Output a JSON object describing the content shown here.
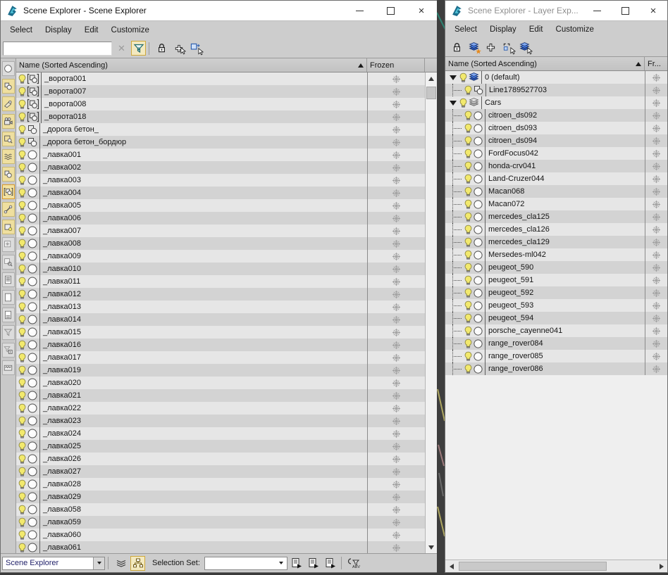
{
  "left_window": {
    "title": "Scene Explorer - Scene Explorer",
    "menu": {
      "select": "Select",
      "display": "Display",
      "edit": "Edit",
      "customize": "Customize"
    },
    "search_value": "",
    "header": {
      "name": "Name (Sorted Ascending)",
      "frozen": "Frozen"
    },
    "rows": [
      {
        "name": "_ворота001",
        "type": "group"
      },
      {
        "name": "_ворота007",
        "type": "group"
      },
      {
        "name": "_ворота008",
        "type": "group"
      },
      {
        "name": "_ворота018",
        "type": "group"
      },
      {
        "name": "_дорога бетон_",
        "type": "shape"
      },
      {
        "name": "_дорога бетон_бордюр",
        "type": "shape"
      },
      {
        "name": "_лавка001",
        "type": "geom"
      },
      {
        "name": "_лавка002",
        "type": "geom"
      },
      {
        "name": "_лавка003",
        "type": "geom"
      },
      {
        "name": "_лавка004",
        "type": "geom"
      },
      {
        "name": "_лавка005",
        "type": "geom"
      },
      {
        "name": "_лавка006",
        "type": "geom"
      },
      {
        "name": "_лавка007",
        "type": "geom"
      },
      {
        "name": "_лавка008",
        "type": "geom"
      },
      {
        "name": "_лавка009",
        "type": "geom"
      },
      {
        "name": "_лавка010",
        "type": "geom"
      },
      {
        "name": "_лавка011",
        "type": "geom"
      },
      {
        "name": "_лавка012",
        "type": "geom"
      },
      {
        "name": "_лавка013",
        "type": "geom"
      },
      {
        "name": "_лавка014",
        "type": "geom"
      },
      {
        "name": "_лавка015",
        "type": "geom"
      },
      {
        "name": "_лавка016",
        "type": "geom"
      },
      {
        "name": "_лавка017",
        "type": "geom"
      },
      {
        "name": "_лавка019",
        "type": "geom"
      },
      {
        "name": "_лавка020",
        "type": "geom"
      },
      {
        "name": "_лавка021",
        "type": "geom"
      },
      {
        "name": "_лавка022",
        "type": "geom"
      },
      {
        "name": "_лавка023",
        "type": "geom"
      },
      {
        "name": "_лавка024",
        "type": "geom"
      },
      {
        "name": "_лавка025",
        "type": "geom"
      },
      {
        "name": "_лавка026",
        "type": "geom"
      },
      {
        "name": "_лавка027",
        "type": "geom"
      },
      {
        "name": "_лавка028",
        "type": "geom"
      },
      {
        "name": "_лавка029",
        "type": "geom"
      },
      {
        "name": "_лавка058",
        "type": "geom"
      },
      {
        "name": "_лавка059",
        "type": "geom"
      },
      {
        "name": "_лавка060",
        "type": "geom"
      },
      {
        "name": "_лавка061",
        "type": "geom"
      }
    ],
    "footer": {
      "explorer_selector": "Scene Explorer",
      "selection_set_label": "Selection Set:",
      "selection_set_value": ""
    },
    "strip_icons": [
      "display-none",
      "display-shapes",
      "display-lights",
      "display-cameras",
      "display-helpers",
      "display-spacewarps",
      "display-groups",
      "display-xrefs",
      "display-bones",
      "display-containers",
      "display-frozen",
      "display-hidden",
      "view-list",
      "view-blank",
      "view-details",
      "filter",
      "filter-combination",
      "filter-custom"
    ]
  },
  "right_window": {
    "title": "Scene Explorer - Layer Exp...",
    "menu": {
      "select": "Select",
      "display": "Display",
      "edit": "Edit",
      "customize": "Customize"
    },
    "header": {
      "name": "Name (Sorted Ascending)",
      "frozen": "Fr..."
    },
    "tree": [
      {
        "label": "0 (default)",
        "type": "layer-blue",
        "level": 0
      },
      {
        "label": "Line1789527703",
        "type": "shape",
        "level": 1
      },
      {
        "label": "Cars",
        "type": "layer-gray",
        "level": 0
      },
      {
        "label": "citroen_ds092",
        "type": "geom",
        "level": 1
      },
      {
        "label": "citroen_ds093",
        "type": "geom",
        "level": 1
      },
      {
        "label": "citroen_ds094",
        "type": "geom",
        "level": 1
      },
      {
        "label": "FordFocus042",
        "type": "geom",
        "level": 1
      },
      {
        "label": "honda-crv041",
        "type": "geom",
        "level": 1
      },
      {
        "label": "Land-Cruzer044",
        "type": "geom",
        "level": 1
      },
      {
        "label": "Macan068",
        "type": "geom",
        "level": 1
      },
      {
        "label": "Macan072",
        "type": "geom",
        "level": 1
      },
      {
        "label": "mercedes_cla125",
        "type": "geom",
        "level": 1
      },
      {
        "label": "mercedes_cla126",
        "type": "geom",
        "level": 1
      },
      {
        "label": "mercedes_cla129",
        "type": "geom",
        "level": 1
      },
      {
        "label": "Mersedes-ml042",
        "type": "geom",
        "level": 1
      },
      {
        "label": "peugeot_590",
        "type": "geom",
        "level": 1
      },
      {
        "label": "peugeot_591",
        "type": "geom",
        "level": 1
      },
      {
        "label": "peugeot_592",
        "type": "geom",
        "level": 1
      },
      {
        "label": "peugeot_593",
        "type": "geom",
        "level": 1
      },
      {
        "label": "peugeot_594",
        "type": "geom",
        "level": 1
      },
      {
        "label": "porsche_cayenne041",
        "type": "geom",
        "level": 1
      },
      {
        "label": "range_rover084",
        "type": "geom",
        "level": 1
      },
      {
        "label": "range_rover085",
        "type": "geom",
        "level": 1
      },
      {
        "label": "range_rover086",
        "type": "geom",
        "level": 1
      }
    ]
  },
  "icons": {
    "snowflake": "frozen-state asterisk, gray",
    "bulb": "visibility lightbulb, yellow",
    "layer-blue": "blue layer stack",
    "layer-gray": "gray layer stack",
    "funnel": "filter funnel",
    "lock": "lock cell editing padlock"
  },
  "colors": {
    "row_light": "#e6e6e6",
    "row_dark": "#d3d3d3",
    "toolbar_bg": "#cdcdcd",
    "highlight_button": "#f3e9c0",
    "strip_button_yellow": "#efdf9f",
    "layer_blue": "#4a7de0",
    "titlebar_inactive_text": "#8f8f8f",
    "viewport_gap": "#3e3e3e"
  }
}
